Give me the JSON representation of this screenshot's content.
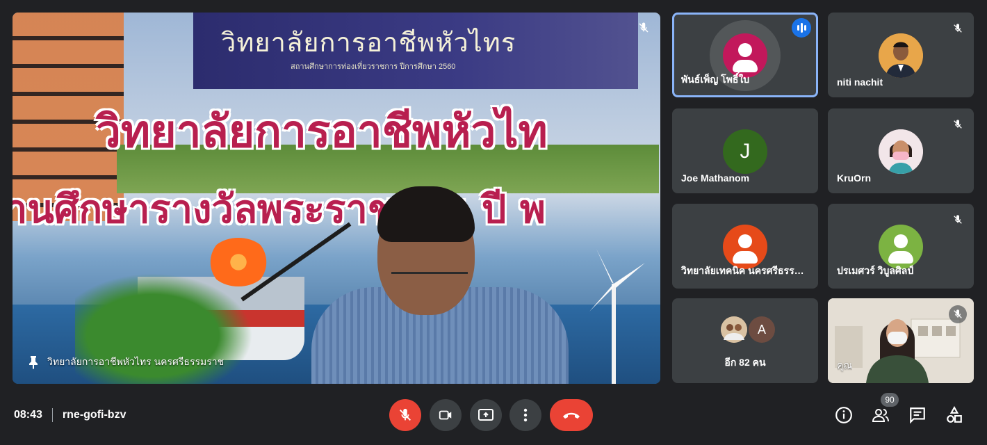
{
  "meeting": {
    "time": "08:43",
    "code": "rne-gofi-bzv",
    "people_count": "90"
  },
  "main_video": {
    "pinned_name": "วิทยาลัยการอาชีพหัวไทร นครศรีธรรมราช",
    "backdrop_title": "วิทยาลัยการอาชีพหัวไทร",
    "backdrop_subtitle": "สถานศึกษาการท่องเที่ยวราชการ ปีการศึกษา 2560",
    "backdrop_big_line1": "วิทยาลัยการอาชีพหัวไท",
    "backdrop_big_line2": "านศึกษารางวัลพระราชทาน ปี พ"
  },
  "participants": [
    {
      "name": "พันธ์เพ็ญ โพธิ์ใบ",
      "avatar_color": "#c2185b",
      "state": "speaking"
    },
    {
      "name": "niti nachit",
      "avatar_color": "#e0a040",
      "state": "muted"
    },
    {
      "name": "Joe Mathanom",
      "avatar_letter": "J",
      "avatar_color": "#33691e",
      "state": "none"
    },
    {
      "name": "KruOrn",
      "avatar_color": "#f0b0c0",
      "state": "muted"
    },
    {
      "name": "วิทยาลัยเทคนิค นครศรีธรรมราช",
      "avatar_color": "#e64a19",
      "state": "none"
    },
    {
      "name": "ปรเมศวร์ วิบูลศิลป์",
      "avatar_color": "#7cb342",
      "state": "muted"
    }
  ],
  "others": {
    "label": "อีก 82 คน",
    "letter": "A",
    "letter_color": "#6d4c41"
  },
  "self_tile": {
    "name": "คุณ",
    "state": "muted"
  },
  "controls": {
    "mic": "mic-off",
    "camera": "camera",
    "present": "present-screen",
    "more": "more-options",
    "hangup": "leave-call"
  },
  "colors": {
    "background": "#202124",
    "tile": "#3c4043",
    "red": "#ea4335",
    "speaking_blue": "#1a73e8",
    "active_border": "#8ab4f8"
  }
}
